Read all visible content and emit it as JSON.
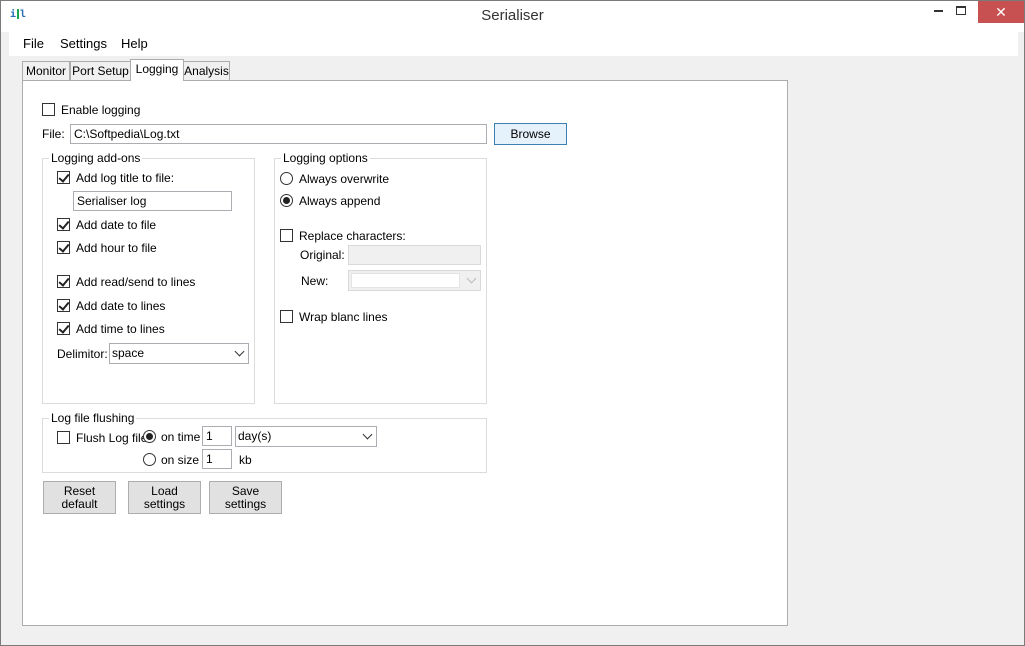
{
  "window": {
    "title": "Serialiser",
    "icon": "serialiser-app-icon",
    "close_glyph": "✕"
  },
  "menu": {
    "items": [
      "File",
      "Settings",
      "Help"
    ]
  },
  "tabs": [
    "Monitor",
    "Port Setup",
    "Logging",
    "Analysis"
  ],
  "active_tab": "Logging",
  "logging": {
    "enable_label": "Enable logging",
    "enable_checked": false,
    "file_label": "File:",
    "file_value": "C:\\Softpedia\\Log.txt",
    "browse_label": "Browse"
  },
  "addons": {
    "title": "Logging add-ons",
    "add_title_label": "Add log title to file:",
    "title_value": "Serialiser log",
    "add_date_file_label": "Add date to file",
    "add_hour_file_label": "Add hour to file",
    "add_readsend_label": "Add read/send to lines",
    "add_date_lines_label": "Add date to lines",
    "add_time_lines_label": "Add time to lines",
    "delimitor_label": "Delimitor:",
    "delimitor_value": "space"
  },
  "options": {
    "title": "Logging options",
    "overwrite_label": "Always overwrite",
    "append_label": "Always append",
    "replace_label": "Replace characters:",
    "original_label": "Original:",
    "new_label": "New:",
    "wrap_label": "Wrap blanc lines"
  },
  "flushing": {
    "title": "Log file flushing",
    "flush_label": "Flush Log file",
    "on_time_label": "on time",
    "on_time_value": "1",
    "time_unit": "day(s)",
    "on_size_label": "on size",
    "on_size_value": "1",
    "size_unit": "kb"
  },
  "buttons": {
    "reset_line1": "Reset",
    "reset_line2": "default",
    "load_line1": "Load",
    "load_line2": "settings",
    "save_line1": "Save",
    "save_line2": "settings"
  }
}
